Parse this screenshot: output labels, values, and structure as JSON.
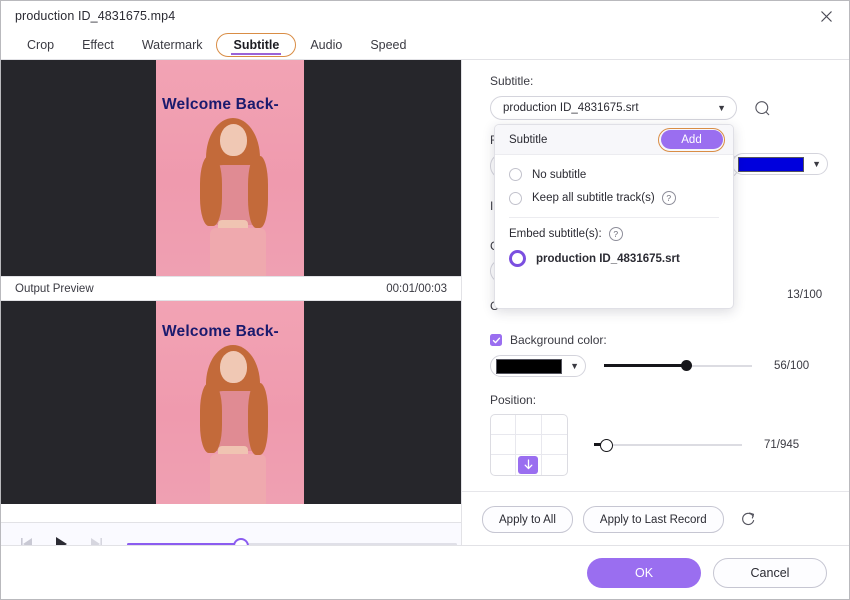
{
  "window": {
    "title": "production ID_4831675.mp4",
    "close_icon": "close-icon"
  },
  "tabs": [
    {
      "label": "Crop",
      "active": false
    },
    {
      "label": "Effect",
      "active": false
    },
    {
      "label": "Watermark",
      "active": false
    },
    {
      "label": "Subtitle",
      "active": true
    },
    {
      "label": "Audio",
      "active": false
    },
    {
      "label": "Speed",
      "active": false
    }
  ],
  "preview": {
    "subtitle_overlay": "Welcome Back-",
    "bar_label": "Output Preview",
    "time": "00:01/00:03",
    "controls": {
      "prev_frame": "previous-frame-icon",
      "play": "play-icon",
      "next_frame": "next-frame-icon",
      "seek_percent": 34
    }
  },
  "settings": {
    "subtitle_label": "Subtitle:",
    "subtitle_value": "production ID_4831675.srt",
    "search_icon": "search-icon",
    "obscured_labels": [
      "F",
      "I",
      "C",
      "C"
    ],
    "font_color_swatch": "#0000dd",
    "opacity_value": "13/100",
    "background": {
      "checkbox_label": "Background color:",
      "checked": true,
      "swatch": "#000000",
      "value": "56/100",
      "slider_percent": 56
    },
    "position": {
      "label": "Position:",
      "selected_cell": 8,
      "arrow_icon": "arrow-down-icon",
      "value": "71/945",
      "slider_percent": 8
    },
    "apply_all": "Apply to All",
    "apply_last": "Apply to Last Record",
    "reset_icon": "reset-icon"
  },
  "popup": {
    "title": "Subtitle",
    "add_label": "Add",
    "options": [
      {
        "label": "No subtitle",
        "checked": false,
        "help": false
      },
      {
        "label": "Keep all subtitle track(s)",
        "checked": false,
        "help": true
      }
    ],
    "embed_label": "Embed subtitle(s):",
    "embed_help": "?",
    "embed_option": {
      "label": "production ID_4831675.srt",
      "checked": true
    }
  },
  "footer": {
    "ok": "OK",
    "cancel": "Cancel"
  },
  "colors": {
    "accent": "#9a6ef0",
    "highlight": "#d98d45",
    "subtitle_text": "#1a1a6e"
  }
}
